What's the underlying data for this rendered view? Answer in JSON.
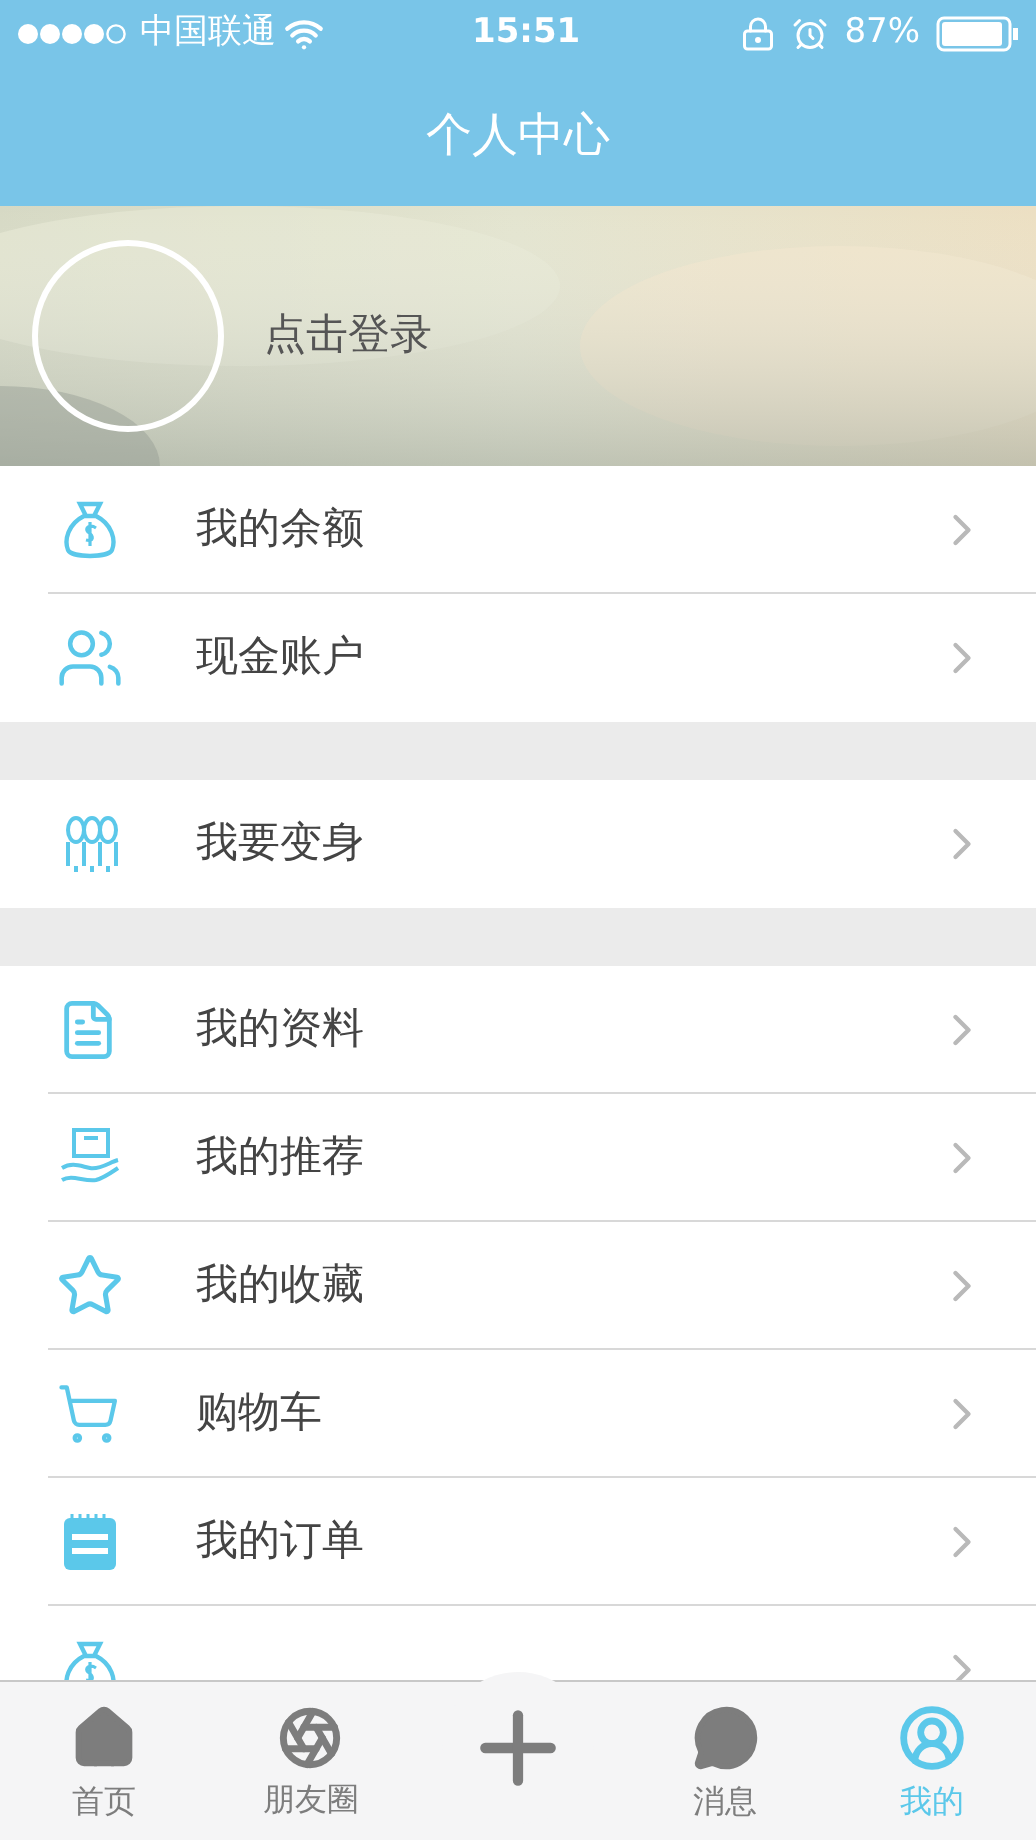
{
  "status_bar": {
    "carrier": "中国联通",
    "time": "15:51",
    "battery": "87%"
  },
  "nav": {
    "title": "个人中心"
  },
  "profile": {
    "login": "点击登录"
  },
  "groups": [
    {
      "items": [
        {
          "kind": "row",
          "label": "我的余额"
        },
        {
          "kind": "row",
          "label": "现金账户"
        }
      ]
    },
    {
      "items": [
        {
          "kind": "row",
          "label": "我要变身"
        }
      ]
    },
    {
      "items": [
        {
          "kind": "row",
          "label": "我的资料"
        },
        {
          "kind": "row",
          "label": "我的推荐"
        },
        {
          "kind": "row",
          "label": "我的收藏"
        },
        {
          "kind": "row",
          "label": "购物车"
        },
        {
          "kind": "row",
          "label": "我的订单"
        },
        {
          "kind": "cut_off"
        }
      ]
    }
  ],
  "tab_bar": [
    {
      "label": "首页",
      "selected": false
    },
    {
      "label": "朋友圈",
      "selected": false
    },
    {
      "kind": "plus",
      "selected": false
    },
    {
      "label": "消息",
      "selected": false
    },
    {
      "label": "我的",
      "selected": true
    }
  ]
}
